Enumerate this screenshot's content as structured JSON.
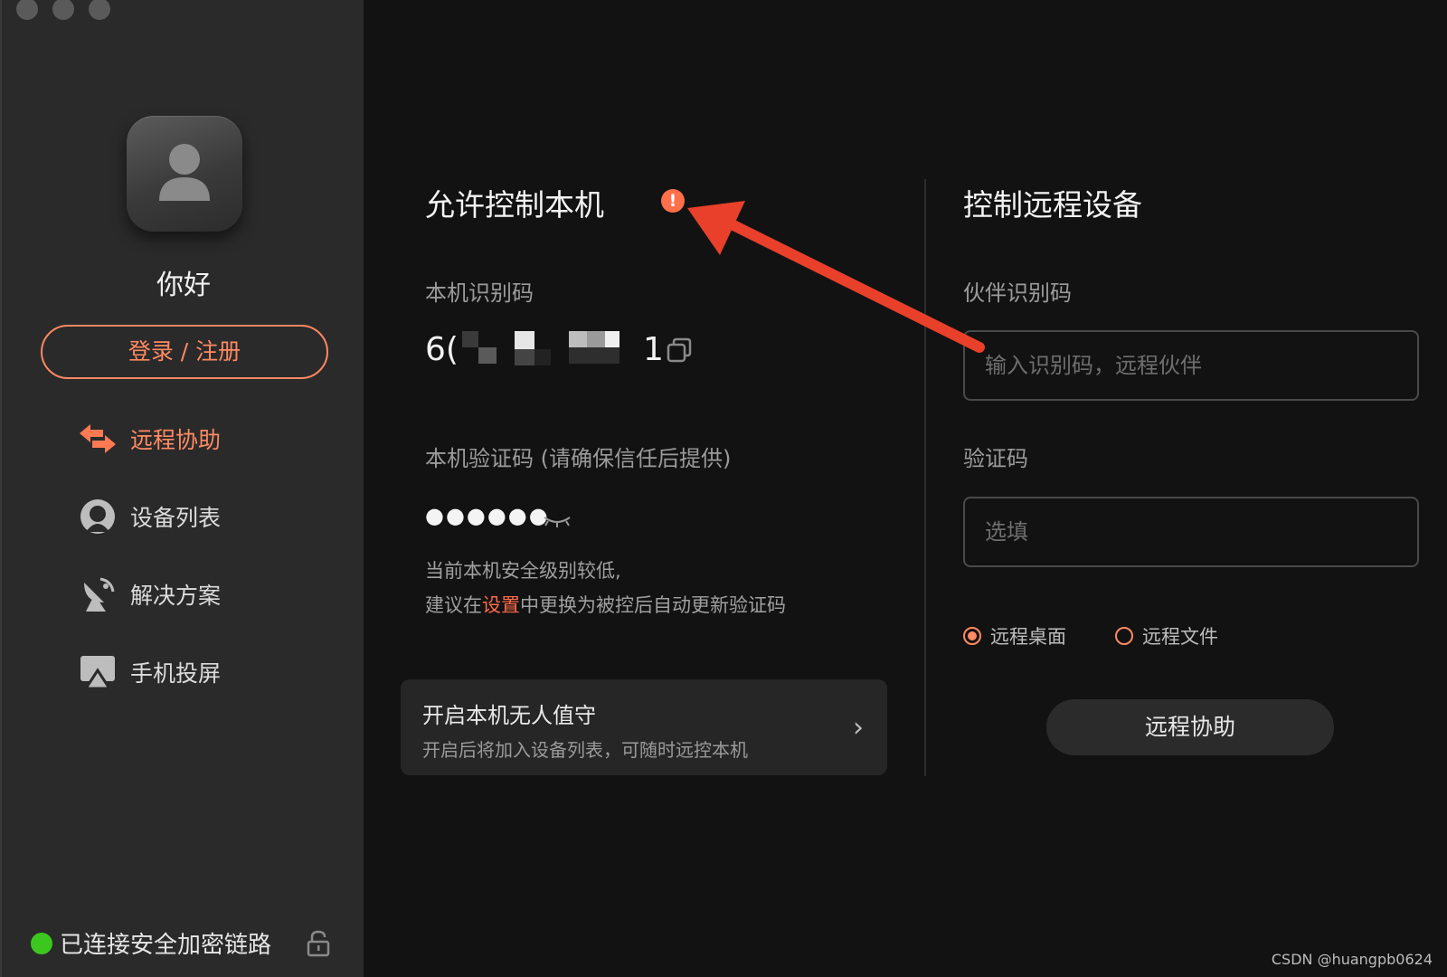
{
  "sidebar": {
    "greeting": "你好",
    "login_label": "登录 / 注册",
    "nav": [
      {
        "label": "远程协助",
        "icon": "remote-assist-icon",
        "active": true
      },
      {
        "label": "设备列表",
        "icon": "device-list-icon",
        "active": false
      },
      {
        "label": "解决方案",
        "icon": "satellite-dish-icon",
        "active": false
      },
      {
        "label": "手机投屏",
        "icon": "screen-cast-icon",
        "active": false
      }
    ],
    "status_text": "已连接安全加密链路"
  },
  "local": {
    "title": "允许控制本机",
    "id_label": "本机识别码",
    "id_value_visible_prefix": "6(",
    "id_value_visible_suffix": "1",
    "code_label": "本机验证码 (请确保信任后提供)",
    "code_value": "●●●●●●",
    "hint_line1": "当前本机安全级别较低,",
    "hint_line2_before": "建议在",
    "hint_link": "设置",
    "hint_line2_after": "中更换为被控后自动更新验证码",
    "unattended_title": "开启本机无人值守",
    "unattended_desc": "开启后将加入设备列表，可随时远控本机"
  },
  "remote": {
    "title": "控制远程设备",
    "partner_label": "伙伴识别码",
    "partner_placeholder": "输入识别码，远程伙伴",
    "code_label": "验证码",
    "code_placeholder": "选填",
    "options": [
      {
        "label": "远程桌面",
        "selected": true
      },
      {
        "label": "远程文件",
        "selected": false
      }
    ],
    "button_label": "远程协助"
  },
  "colors": {
    "accent": "#ff8a62",
    "arrow": "#e8402a",
    "status_green": "#3cc71f"
  },
  "watermark": "CSDN @huangpb0624"
}
